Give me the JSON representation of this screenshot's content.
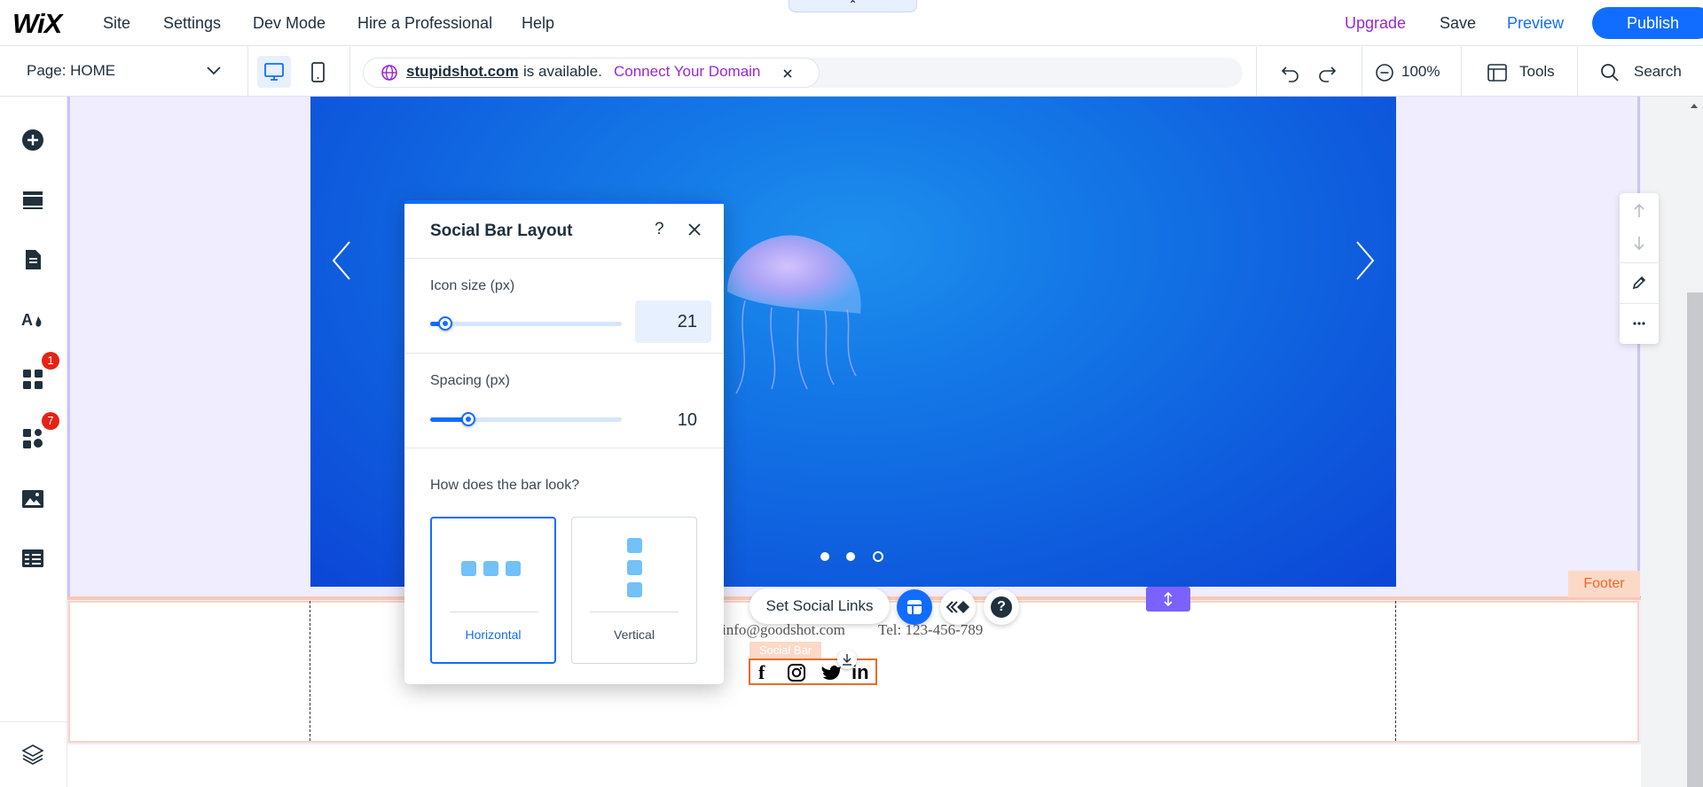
{
  "topbar": {
    "logo": "WiX",
    "menu": [
      "Site",
      "Settings",
      "Dev Mode",
      "Hire a Professional",
      "Help"
    ],
    "upgrade": "Upgrade",
    "save": "Save",
    "preview": "Preview",
    "publish": "Publish",
    "collapse": "⌃"
  },
  "subbar": {
    "page_select": "Page: HOME",
    "domain_name": "stupidshot.com",
    "domain_available": "is available.",
    "connect_domain": "Connect Your Domain",
    "zoom": "100%",
    "tools": "Tools",
    "search": "Search"
  },
  "sidebar": {
    "badges": [
      "1",
      "7"
    ]
  },
  "dialog": {
    "title": "Social Bar Layout",
    "help": "?",
    "icon_size_label": "Icon size (px)",
    "icon_size_value": "21",
    "icon_size_fraction": 0.08,
    "spacing_label": "Spacing (px)",
    "spacing_value": "10",
    "spacing_fraction": 0.2,
    "look_question": "How does the bar look?",
    "options": [
      "Horizontal",
      "Vertical"
    ],
    "selected_option": "Horizontal"
  },
  "canvas": {
    "footer_tag": "Footer",
    "set_social_links": "Set Social Links",
    "email": "info@goodshot.com",
    "phone": "Tel: 123-456-789",
    "social_bar_tag": "Social Bar",
    "social_icons": [
      "facebook-icon",
      "instagram-icon",
      "twitter-icon",
      "linkedin-icon"
    ],
    "linkedin_text": "in",
    "facebook_text": "f",
    "help_bubble": "?"
  },
  "colors": {
    "accent": "#116dff",
    "upgrade": "#9a27d5",
    "badge": "#e62214",
    "footer_tag_bg": "#fcd9c7",
    "footer_tag_text": "#e86b2b",
    "stretch_handle": "#7b61ff"
  }
}
